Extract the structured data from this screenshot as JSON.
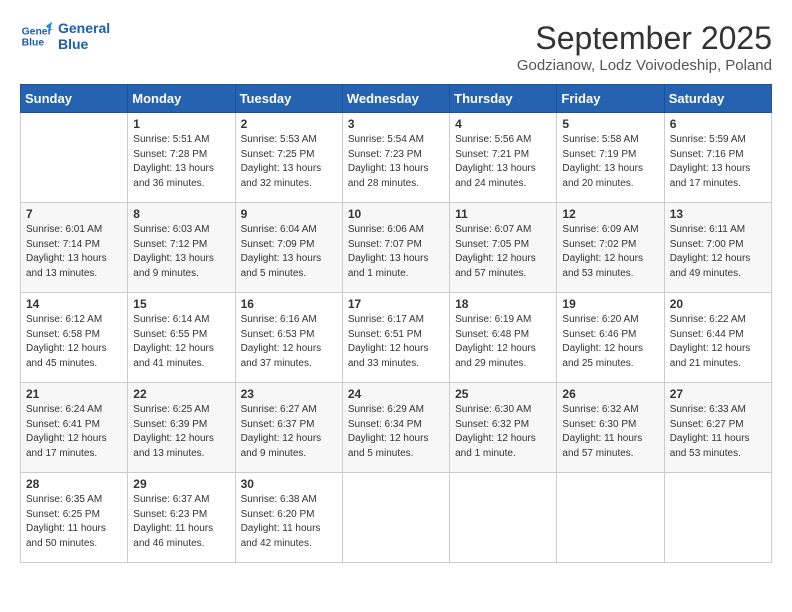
{
  "logo": {
    "line1": "General",
    "line2": "Blue"
  },
  "title": "September 2025",
  "subtitle": "Godzianow, Lodz Voivodeship, Poland",
  "days_of_week": [
    "Sunday",
    "Monday",
    "Tuesday",
    "Wednesday",
    "Thursday",
    "Friday",
    "Saturday"
  ],
  "weeks": [
    [
      {
        "day": "",
        "info": ""
      },
      {
        "day": "1",
        "info": "Sunrise: 5:51 AM\nSunset: 7:28 PM\nDaylight: 13 hours\nand 36 minutes."
      },
      {
        "day": "2",
        "info": "Sunrise: 5:53 AM\nSunset: 7:25 PM\nDaylight: 13 hours\nand 32 minutes."
      },
      {
        "day": "3",
        "info": "Sunrise: 5:54 AM\nSunset: 7:23 PM\nDaylight: 13 hours\nand 28 minutes."
      },
      {
        "day": "4",
        "info": "Sunrise: 5:56 AM\nSunset: 7:21 PM\nDaylight: 13 hours\nand 24 minutes."
      },
      {
        "day": "5",
        "info": "Sunrise: 5:58 AM\nSunset: 7:19 PM\nDaylight: 13 hours\nand 20 minutes."
      },
      {
        "day": "6",
        "info": "Sunrise: 5:59 AM\nSunset: 7:16 PM\nDaylight: 13 hours\nand 17 minutes."
      }
    ],
    [
      {
        "day": "7",
        "info": "Sunrise: 6:01 AM\nSunset: 7:14 PM\nDaylight: 13 hours\nand 13 minutes."
      },
      {
        "day": "8",
        "info": "Sunrise: 6:03 AM\nSunset: 7:12 PM\nDaylight: 13 hours\nand 9 minutes."
      },
      {
        "day": "9",
        "info": "Sunrise: 6:04 AM\nSunset: 7:09 PM\nDaylight: 13 hours\nand 5 minutes."
      },
      {
        "day": "10",
        "info": "Sunrise: 6:06 AM\nSunset: 7:07 PM\nDaylight: 13 hours\nand 1 minute."
      },
      {
        "day": "11",
        "info": "Sunrise: 6:07 AM\nSunset: 7:05 PM\nDaylight: 12 hours\nand 57 minutes."
      },
      {
        "day": "12",
        "info": "Sunrise: 6:09 AM\nSunset: 7:02 PM\nDaylight: 12 hours\nand 53 minutes."
      },
      {
        "day": "13",
        "info": "Sunrise: 6:11 AM\nSunset: 7:00 PM\nDaylight: 12 hours\nand 49 minutes."
      }
    ],
    [
      {
        "day": "14",
        "info": "Sunrise: 6:12 AM\nSunset: 6:58 PM\nDaylight: 12 hours\nand 45 minutes."
      },
      {
        "day": "15",
        "info": "Sunrise: 6:14 AM\nSunset: 6:55 PM\nDaylight: 12 hours\nand 41 minutes."
      },
      {
        "day": "16",
        "info": "Sunrise: 6:16 AM\nSunset: 6:53 PM\nDaylight: 12 hours\nand 37 minutes."
      },
      {
        "day": "17",
        "info": "Sunrise: 6:17 AM\nSunset: 6:51 PM\nDaylight: 12 hours\nand 33 minutes."
      },
      {
        "day": "18",
        "info": "Sunrise: 6:19 AM\nSunset: 6:48 PM\nDaylight: 12 hours\nand 29 minutes."
      },
      {
        "day": "19",
        "info": "Sunrise: 6:20 AM\nSunset: 6:46 PM\nDaylight: 12 hours\nand 25 minutes."
      },
      {
        "day": "20",
        "info": "Sunrise: 6:22 AM\nSunset: 6:44 PM\nDaylight: 12 hours\nand 21 minutes."
      }
    ],
    [
      {
        "day": "21",
        "info": "Sunrise: 6:24 AM\nSunset: 6:41 PM\nDaylight: 12 hours\nand 17 minutes."
      },
      {
        "day": "22",
        "info": "Sunrise: 6:25 AM\nSunset: 6:39 PM\nDaylight: 12 hours\nand 13 minutes."
      },
      {
        "day": "23",
        "info": "Sunrise: 6:27 AM\nSunset: 6:37 PM\nDaylight: 12 hours\nand 9 minutes."
      },
      {
        "day": "24",
        "info": "Sunrise: 6:29 AM\nSunset: 6:34 PM\nDaylight: 12 hours\nand 5 minutes."
      },
      {
        "day": "25",
        "info": "Sunrise: 6:30 AM\nSunset: 6:32 PM\nDaylight: 12 hours\nand 1 minute."
      },
      {
        "day": "26",
        "info": "Sunrise: 6:32 AM\nSunset: 6:30 PM\nDaylight: 11 hours\nand 57 minutes."
      },
      {
        "day": "27",
        "info": "Sunrise: 6:33 AM\nSunset: 6:27 PM\nDaylight: 11 hours\nand 53 minutes."
      }
    ],
    [
      {
        "day": "28",
        "info": "Sunrise: 6:35 AM\nSunset: 6:25 PM\nDaylight: 11 hours\nand 50 minutes."
      },
      {
        "day": "29",
        "info": "Sunrise: 6:37 AM\nSunset: 6:23 PM\nDaylight: 11 hours\nand 46 minutes."
      },
      {
        "day": "30",
        "info": "Sunrise: 6:38 AM\nSunset: 6:20 PM\nDaylight: 11 hours\nand 42 minutes."
      },
      {
        "day": "",
        "info": ""
      },
      {
        "day": "",
        "info": ""
      },
      {
        "day": "",
        "info": ""
      },
      {
        "day": "",
        "info": ""
      }
    ]
  ]
}
